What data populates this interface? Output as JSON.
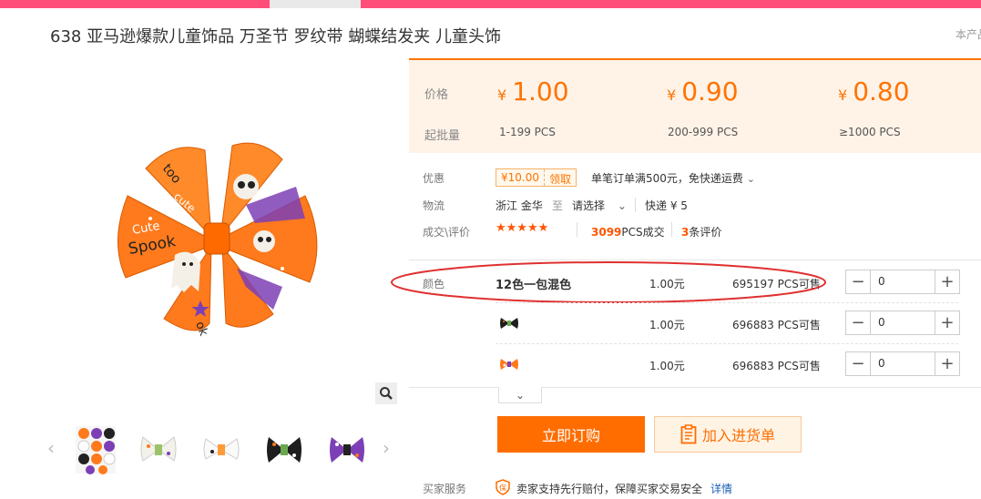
{
  "title": "638 亚马逊爆款儿童饰品 万圣节 罗纹带 蝴蝶结发夹 儿童头饰",
  "corner_text": "本产品",
  "colors": {
    "accent": "#ff7300",
    "topbar": "#ff4e7a",
    "price_bg": "#fff3e8"
  },
  "price_box": {
    "price_label": "价格",
    "moq_label": "起批量",
    "currency": "¥",
    "tiers": [
      {
        "price": "1.00",
        "range": "1-199  PCS"
      },
      {
        "price": "0.90",
        "range": "200-999  PCS"
      },
      {
        "price": "0.80",
        "range": "≥1000  PCS"
      }
    ]
  },
  "promo": {
    "label": "优惠",
    "coupon_amount": "¥10.00",
    "coupon_action": "领取",
    "text": "单笔订单满500元，免快递运费"
  },
  "logistics": {
    "label": "物流",
    "origin": "浙江 金华",
    "to": "至",
    "dest": "请选择",
    "express": "快递 ¥ 5"
  },
  "deals": {
    "label": "成交\\评价",
    "stars": "★★★★★",
    "sold_count": "3099",
    "sold_text": "PCS成交",
    "review_count": "3",
    "review_text": "条评价"
  },
  "sku": {
    "label": "颜色",
    "rows": [
      {
        "name": "12色一包混色",
        "price": "1.00元",
        "stock": "695197 PCS可售",
        "qty": "0"
      },
      {
        "name": "",
        "price": "1.00元",
        "stock": "696883 PCS可售",
        "qty": "0"
      },
      {
        "name": "",
        "price": "1.00元",
        "stock": "696883 PCS可售",
        "qty": "0"
      }
    ]
  },
  "actions": {
    "buy_now": "立即订购",
    "add_to_list": "加入进货单"
  },
  "service": {
    "label": "买家服务",
    "text": "卖家支持先行赔付，保障买家交易安全",
    "link": "详情"
  }
}
